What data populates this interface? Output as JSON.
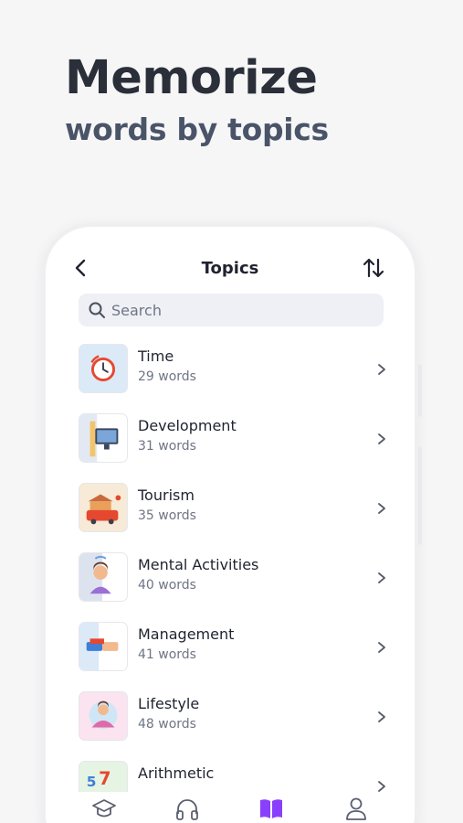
{
  "promo": {
    "headline": "Memorize",
    "subheadline": "words by topics"
  },
  "nav": {
    "title": "Topics",
    "back_icon": "chevron-left-icon",
    "sort_icon": "sort-arrows-icon"
  },
  "search": {
    "placeholder": "Search",
    "icon": "search-icon"
  },
  "topics": [
    {
      "name": "Time",
      "count": "29 words",
      "icon": "clock-icon"
    },
    {
      "name": "Development",
      "count": "31 words",
      "icon": "computer-icon"
    },
    {
      "name": "Tourism",
      "count": "35 words",
      "icon": "bus-icon"
    },
    {
      "name": "Mental Activities",
      "count": "40 words",
      "icon": "thinking-person-icon"
    },
    {
      "name": "Management",
      "count": "41 words",
      "icon": "handshake-icon"
    },
    {
      "name": "Lifestyle",
      "count": "48 words",
      "icon": "meditation-icon"
    },
    {
      "name": "Arithmetic",
      "count": "",
      "icon": "numbers-icon"
    }
  ],
  "tabbar": {
    "items": [
      "graduation-cap-icon",
      "headphones-icon",
      "book-icon",
      "profile-icon"
    ],
    "active_index": 2
  },
  "colors": {
    "accent": "#8a3ffc",
    "text_primary": "#1f2330",
    "text_secondary": "#6f7585",
    "search_bg": "#eef0f5"
  }
}
